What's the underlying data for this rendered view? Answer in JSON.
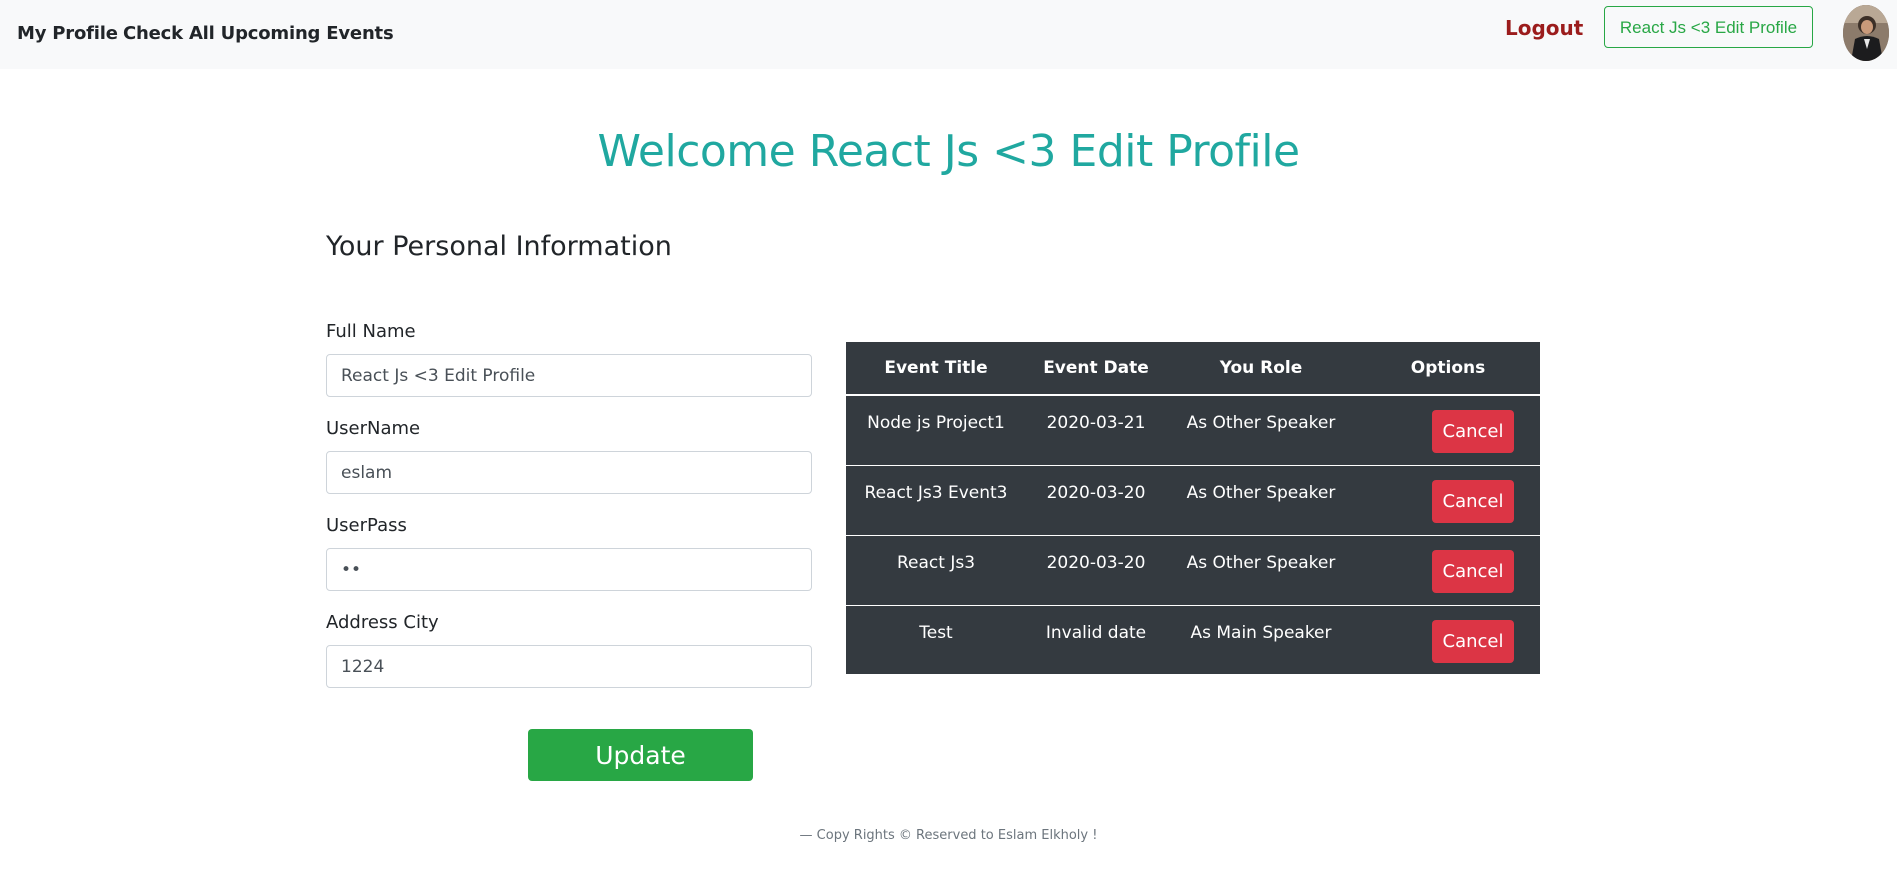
{
  "nav": {
    "my_profile": "My Profile",
    "upcoming_events": "Check All Upcoming Events",
    "logout": "Logout",
    "profile_button": "React Js <3 Edit Profile",
    "avatar_icon": "user-avatar-photo"
  },
  "heading": {
    "welcome": "Welcome React Js <3 Edit Profile",
    "section": "Your Personal Information"
  },
  "form": {
    "full_name_label": "Full Name",
    "full_name_value": "React Js <3 Edit Profile",
    "username_label": "UserName",
    "username_value": "eslam",
    "userpass_label": "UserPass",
    "userpass_value": "••",
    "address_label": "Address City",
    "address_value": "1224",
    "update_button": "Update"
  },
  "table": {
    "headers": [
      "Event Title",
      "Event Date",
      "You Role",
      "Options"
    ],
    "rows": [
      {
        "title": "Node js Project1",
        "date": "2020-03-21",
        "role": "As Other Speaker",
        "action": "Cancel"
      },
      {
        "title": "React Js3 Event3",
        "date": "2020-03-20",
        "role": "As Other Speaker",
        "action": "Cancel"
      },
      {
        "title": "React Js3",
        "date": "2020-03-20",
        "role": "As Other Speaker",
        "action": "Cancel"
      },
      {
        "title": "Test",
        "date": "Invalid date",
        "role": "As Main Speaker",
        "action": "Cancel"
      }
    ]
  },
  "footer": {
    "text": "— Copy Rights © Reserved to Eslam Elkholy !"
  },
  "colors": {
    "accent_teal": "#20a8a0",
    "success_green": "#28a745",
    "danger_red": "#dc3545",
    "logout_red": "#9b1c1c",
    "table_dark": "#343a40"
  }
}
